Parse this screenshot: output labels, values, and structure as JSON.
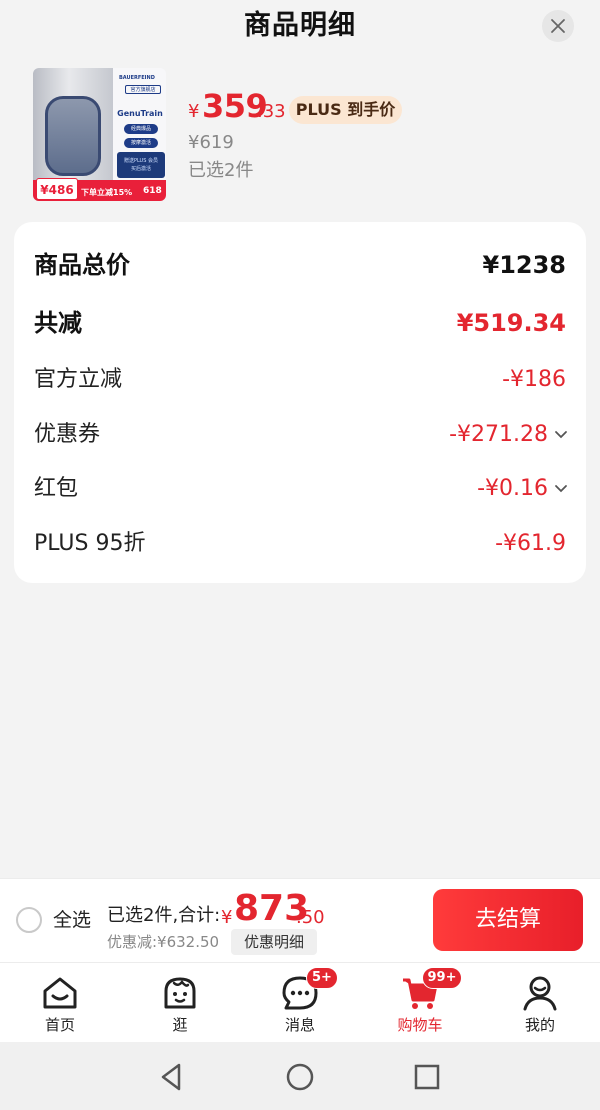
{
  "header": {
    "title": "商品明细"
  },
  "product": {
    "image": {
      "brand": "BAUERFEIND",
      "official": "官方旗舰店",
      "model": "GenuTrain",
      "pill1": "经典爆品",
      "pill2": "按摩激活",
      "plus_line1": "赠送PLUS 会员",
      "plus_line2": "买后激活",
      "promo_price": "¥486",
      "promo_text": "下单立减15%",
      "promo_event": "618"
    },
    "price_symbol": "¥",
    "price_int": "359",
    "price_dec": ".33",
    "plus_tag": "PLUS 到手价",
    "original_price": "¥619",
    "selected_count": "已选2件"
  },
  "breakdown": [
    {
      "label": "商品总价",
      "value": "¥1238"
    },
    {
      "label": "共减",
      "value": "¥519.34"
    },
    {
      "label": "官方立减",
      "value": "-¥186"
    },
    {
      "label": "优惠券",
      "value": "-¥271.28"
    },
    {
      "label": "红包",
      "value": "-¥0.16"
    },
    {
      "label": "PLUS 95折",
      "value": "-¥61.9"
    }
  ],
  "footer": {
    "select_all": "全选",
    "total_label": "已选2件,合计:",
    "total_symbol": "¥",
    "total_int": "873",
    "total_dec": ".50",
    "discount": "优惠减:¥632.50",
    "detail_button": "优惠明细",
    "checkout_button": "去结算"
  },
  "tabs": [
    {
      "label": "首页",
      "icon": "home-icon"
    },
    {
      "label": "逛",
      "icon": "browse-icon"
    },
    {
      "label": "消息",
      "icon": "message-icon",
      "badge": "5+"
    },
    {
      "label": "购物车",
      "icon": "cart-icon",
      "badge": "99+",
      "active": true
    },
    {
      "label": "我的",
      "icon": "profile-icon"
    }
  ],
  "colors": {
    "accent": "#e3262f",
    "plus_tag_bg": "#fbe6d2",
    "background": "#f3f3f3"
  }
}
